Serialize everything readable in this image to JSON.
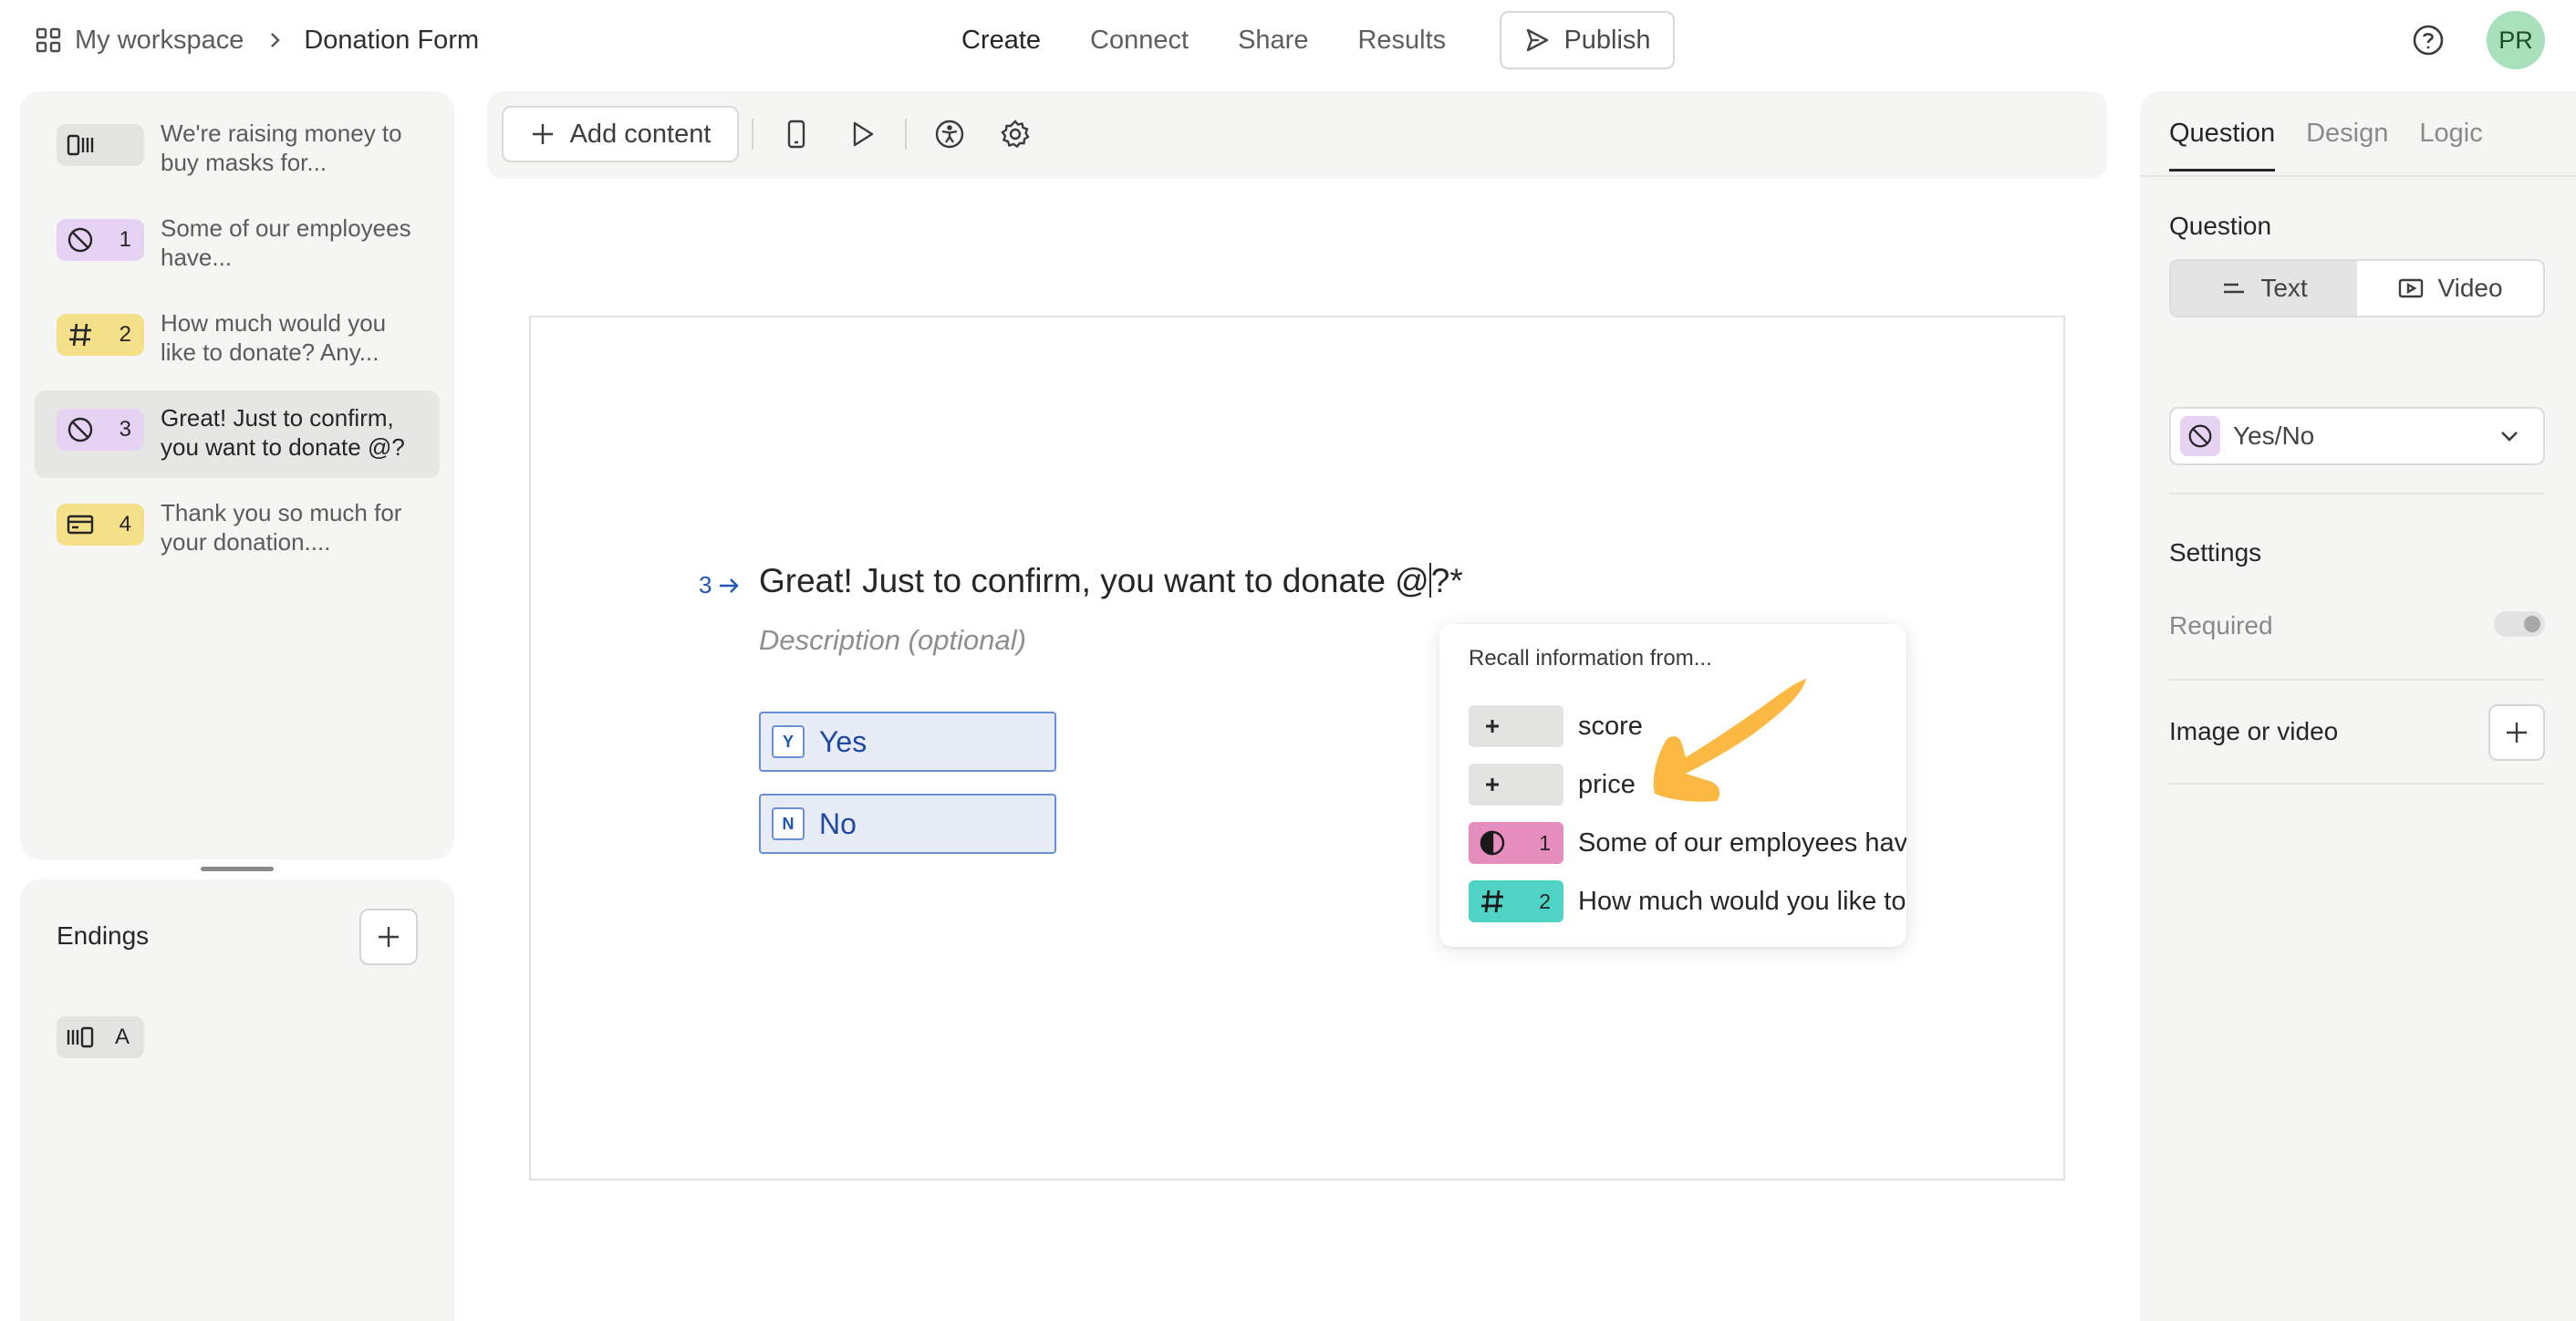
{
  "breadcrumb": {
    "workspace": "My workspace",
    "form": "Donation Form"
  },
  "nav": {
    "create": "Create",
    "connect": "Connect",
    "share": "Share",
    "results": "Results",
    "publish": "Publish"
  },
  "user": {
    "initials": "PR"
  },
  "questions": [
    {
      "number": "",
      "text": "We're raising money to buy masks for...",
      "badge_color": "#e3e3e2",
      "icon": "welcome-screen-icon"
    },
    {
      "number": "1",
      "text": "Some of our employees have...",
      "badge_color": "#e6d2f2",
      "icon": "yes-no-icon"
    },
    {
      "number": "2",
      "text": "How much would you like to donate? Any...",
      "badge_color": "#f5e08a",
      "icon": "hashtag-icon"
    },
    {
      "number": "3",
      "text": "Great! Just to confirm, you want to donate @?",
      "badge_color": "#e6d2f2",
      "icon": "yes-no-icon"
    },
    {
      "number": "4",
      "text": "Thank you so much for your donation....",
      "badge_color": "#f5e08a",
      "icon": "payment-card-icon"
    }
  ],
  "endings": {
    "title": "Endings",
    "items": [
      {
        "label": "A"
      }
    ]
  },
  "toolbar": {
    "add_content": "Add content"
  },
  "canvas": {
    "question_number": "3",
    "title_before_caret": "Great! Just to confirm, you want to donate @",
    "title_after_caret": "?*",
    "description_placeholder": "Description (optional)",
    "choices": [
      {
        "key": "Y",
        "label": "Yes"
      },
      {
        "key": "N",
        "label": "No"
      }
    ]
  },
  "recall": {
    "title": "Recall information from...",
    "items": [
      {
        "badge": "",
        "label": "score",
        "color": "#e3e3e2",
        "icon": "plus-icon"
      },
      {
        "badge": "",
        "label": "price",
        "color": "#e3e3e2",
        "icon": "plus-icon"
      },
      {
        "badge": "1",
        "label": "Some of our employees have",
        "color": "#e58dbd",
        "icon": "contrast-icon"
      },
      {
        "badge": "2",
        "label": "How much would you like to",
        "color": "#4fd3c4",
        "icon": "hashtag-icon"
      }
    ]
  },
  "right_panel": {
    "tabs": [
      "Question",
      "Design",
      "Logic"
    ],
    "question_label": "Question",
    "text_btn": "Text",
    "video_btn": "Video",
    "question_type": "Yes/No",
    "settings_label": "Settings",
    "required_label": "Required",
    "required": false,
    "image_video_label": "Image or video"
  },
  "colors": {
    "accent": "#1f56b8",
    "choice_bg": "#e7ecf7",
    "annotation_arrow": "#fbb943"
  }
}
